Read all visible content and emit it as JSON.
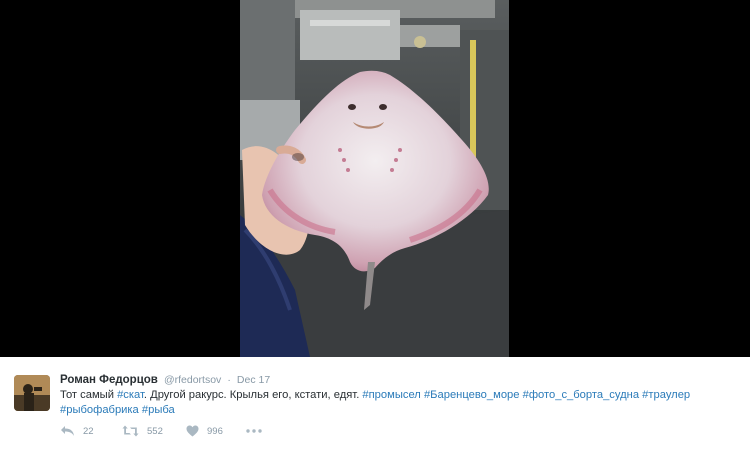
{
  "tweet": {
    "fullname": "Роман Федорцов",
    "username": "@rfedortsov",
    "separator": "·",
    "time": "Dec 17",
    "text_parts": {
      "p1": "Тот самый ",
      "l1": "#скат",
      "p2": ". Другой ракурс. Крылья его, кстати, едят. ",
      "l2": "#промысел",
      "s2": " ",
      "l3": "#Баренцево_море",
      "s3": " ",
      "l4": "#фото_с_борта_судна",
      "s4": " ",
      "l5": "#траулер",
      "s5": " ",
      "l6": "#рыбофабрика",
      "s6": " ",
      "l7": "#рыба"
    },
    "actions": {
      "reply_icon": "reply-icon",
      "reply_count": "22",
      "retweet_icon": "retweet-icon",
      "retweet_count": "552",
      "like_icon": "heart-icon",
      "like_count": "996",
      "more_icon": "more-dots-icon"
    }
  },
  "colors": {
    "media_background": "#000000",
    "link": "#2b7bb9",
    "name": "#292f33",
    "meta": "#8899a6",
    "action_icon": "#aab8c2"
  }
}
